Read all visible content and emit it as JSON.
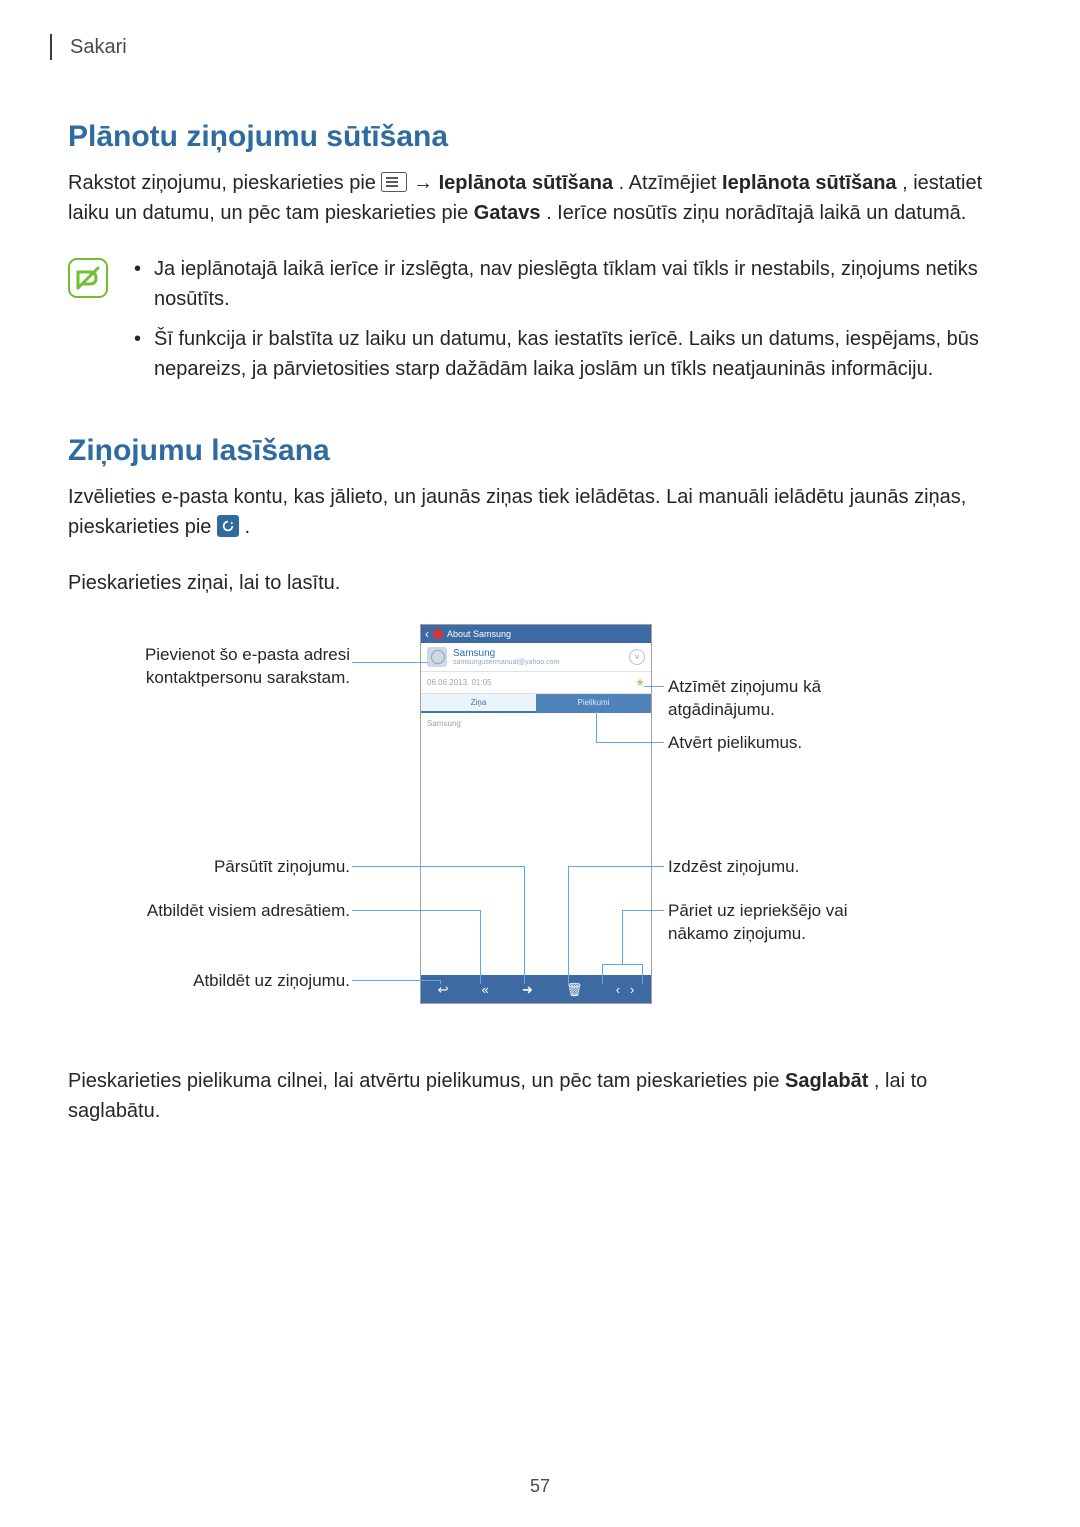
{
  "running_head": "Sakari",
  "page_number": "57",
  "section1": {
    "title": "Plānotu ziņojumu sūtīšana",
    "p1_a": "Rakstot ziņojumu, pieskarieties pie ",
    "p1_b": " → ",
    "p1_bold1": "Ieplānota sūtīšana",
    "p1_c": ". Atzīmējiet ",
    "p1_bold2": "Ieplānota sūtīšana",
    "p1_d": ", iestatiet laiku un datumu, un pēc tam pieskarieties pie ",
    "p1_bold3": "Gatavs",
    "p1_e": ". Ierīce nosūtīs ziņu norādītajā laikā un datumā.",
    "note1": "Ja ieplānotajā laikā ierīce ir izslēgta, nav pieslēgta tīklam vai tīkls ir nestabils, ziņojums netiks nosūtīts.",
    "note2": "Šī funkcija ir balstīta uz laiku un datumu, kas iestatīts ierīcē. Laiks un datums, iespējams, būs nepareizs, ja pārvietosities starp dažādām laika joslām un tīkls neatjauninās informāciju."
  },
  "section2": {
    "title": "Ziņojumu lasīšana",
    "p1": "Izvēlieties e-pasta kontu, kas jālieto, un jaunās ziņas tiek ielādētas. Lai manuāli ielādētu jaunās ziņas, pieskarieties pie ",
    "p1_end": ".",
    "p2": "Pieskarieties ziņai, lai to lasītu.",
    "p3_a": "Pieskarieties pielikuma cilnei, lai atvērtu pielikumus, un pēc tam pieskarieties pie ",
    "p3_bold": "Saglabāt",
    "p3_b": ", lai to saglabātu."
  },
  "phone": {
    "topbar_title": "About Samsung",
    "sender_name": "Samsung",
    "sender_email": "samsungusermanual@yahoo.com",
    "timestamp": "06.06.2013. 01:05",
    "tab_message": "Ziņa",
    "tab_attachments": "Pielikumi",
    "body_text": "Samsung"
  },
  "callouts": {
    "contact": "Pievienot šo e-pasta adresi kontaktpersonu sarakstam.",
    "reminder": "Atzīmēt ziņojumu kā atgādinājumu.",
    "attach": "Atvērt pielikumus.",
    "forward": "Pārsūtīt ziņojumu.",
    "delete": "Izdzēst ziņojumu.",
    "replyall": "Atbildēt visiem adresātiem.",
    "nav": "Pāriet uz iepriekšējo vai nākamo ziņojumu.",
    "reply": "Atbildēt uz ziņojumu."
  }
}
